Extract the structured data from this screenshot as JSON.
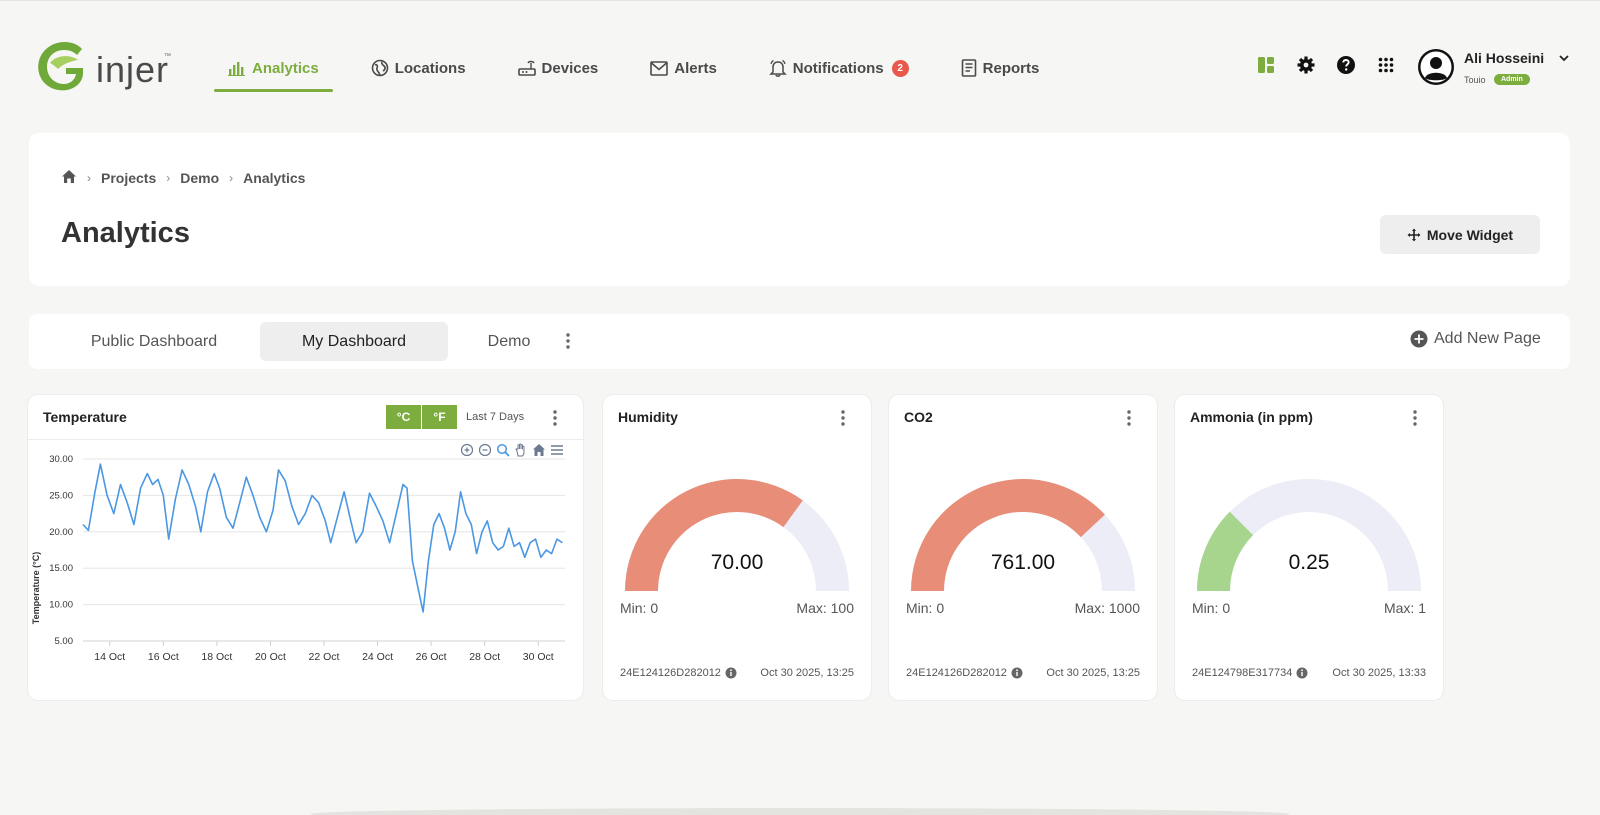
{
  "app": {
    "logo_text": "injer",
    "logo_tm": "™"
  },
  "nav": {
    "items": [
      {
        "label": "Analytics",
        "icon": "bar-chart-icon",
        "active": true
      },
      {
        "label": "Locations",
        "icon": "globe-icon"
      },
      {
        "label": "Devices",
        "icon": "router-icon"
      },
      {
        "label": "Alerts",
        "icon": "mail-icon"
      },
      {
        "label": "Notifications",
        "icon": "bell-icon",
        "badge": "2"
      },
      {
        "label": "Reports",
        "icon": "report-icon"
      }
    ]
  },
  "user": {
    "name": "Ali Hosseini",
    "org": "Touio",
    "role": "Admin"
  },
  "breadcrumb": [
    "Projects",
    "Demo",
    "Analytics"
  ],
  "page": {
    "title": "Analytics",
    "move_widget_label": "Move Widget"
  },
  "tabs": {
    "items": [
      "Public Dashboard",
      "My Dashboard",
      "Demo"
    ],
    "active": "My Dashboard",
    "add_label": "Add New Page"
  },
  "colors": {
    "brand": "#7cad3e",
    "gauge_high": "#e88d77",
    "gauge_low": "#a7d58e",
    "gauge_track": "#ededf7",
    "line": "#4a97e3",
    "badge": "#e9594b"
  },
  "temperature": {
    "title": "Temperature",
    "unit_c": "°C",
    "unit_f": "°F",
    "range": "Last 7 Days"
  },
  "chart_data": {
    "type": "line",
    "title": "Temperature",
    "ylabel": "Temperature (°C)",
    "xlabel": "",
    "ylim": [
      5,
      30
    ],
    "yticks": [
      "30.00",
      "25.00",
      "20.00",
      "15.00",
      "10.00",
      "5.00"
    ],
    "xticks": [
      "14 Oct",
      "16 Oct",
      "18 Oct",
      "20 Oct",
      "22 Oct",
      "24 Oct",
      "26 Oct",
      "28 Oct",
      "30 Oct"
    ],
    "xlim_days": [
      13,
      31
    ],
    "grid": true,
    "series": [
      {
        "values": [
          [
            13.0,
            21.0
          ],
          [
            13.2,
            20.2
          ],
          [
            13.45,
            25.5
          ],
          [
            13.65,
            29.3
          ],
          [
            13.9,
            25.0
          ],
          [
            14.15,
            22.5
          ],
          [
            14.4,
            26.5
          ],
          [
            14.65,
            24.0
          ],
          [
            14.9,
            21.0
          ],
          [
            15.15,
            26.0
          ],
          [
            15.4,
            28.0
          ],
          [
            15.6,
            26.5
          ],
          [
            15.8,
            27.2
          ],
          [
            16.0,
            25.0
          ],
          [
            16.2,
            19.0
          ],
          [
            16.45,
            24.5
          ],
          [
            16.7,
            28.5
          ],
          [
            16.95,
            26.5
          ],
          [
            17.2,
            23.5
          ],
          [
            17.4,
            20.0
          ],
          [
            17.65,
            25.5
          ],
          [
            17.9,
            28.0
          ],
          [
            18.1,
            26.0
          ],
          [
            18.35,
            22.0
          ],
          [
            18.6,
            20.5
          ],
          [
            18.85,
            24.0
          ],
          [
            19.1,
            27.5
          ],
          [
            19.35,
            25.0
          ],
          [
            19.6,
            22.0
          ],
          [
            19.85,
            20.0
          ],
          [
            20.1,
            23.0
          ],
          [
            20.3,
            28.5
          ],
          [
            20.55,
            27.0
          ],
          [
            20.8,
            23.5
          ],
          [
            21.05,
            21.0
          ],
          [
            21.3,
            22.5
          ],
          [
            21.55,
            25.0
          ],
          [
            21.8,
            24.0
          ],
          [
            22.05,
            21.5
          ],
          [
            22.25,
            18.5
          ],
          [
            22.5,
            22.0
          ],
          [
            22.75,
            25.5
          ],
          [
            23.0,
            21.5
          ],
          [
            23.2,
            18.5
          ],
          [
            23.45,
            20.0
          ],
          [
            23.7,
            25.3
          ],
          [
            23.95,
            23.5
          ],
          [
            24.2,
            21.5
          ],
          [
            24.45,
            18.5
          ],
          [
            24.7,
            22.5
          ],
          [
            24.95,
            26.5
          ],
          [
            25.1,
            26.0
          ],
          [
            25.3,
            16.0
          ],
          [
            25.5,
            12.5
          ],
          [
            25.7,
            9.0
          ],
          [
            25.9,
            16.0
          ],
          [
            26.1,
            21.0
          ],
          [
            26.3,
            22.5
          ],
          [
            26.5,
            20.5
          ],
          [
            26.7,
            17.5
          ],
          [
            26.9,
            20.0
          ],
          [
            27.1,
            25.5
          ],
          [
            27.3,
            22.5
          ],
          [
            27.5,
            21.0
          ],
          [
            27.7,
            17.0
          ],
          [
            27.9,
            20.0
          ],
          [
            28.1,
            21.5
          ],
          [
            28.3,
            18.5
          ],
          [
            28.5,
            17.5
          ],
          [
            28.7,
            18.0
          ],
          [
            28.9,
            20.5
          ],
          [
            29.1,
            18.0
          ],
          [
            29.3,
            18.5
          ],
          [
            29.5,
            16.5
          ],
          [
            29.7,
            18.5
          ],
          [
            29.9,
            19.0
          ],
          [
            30.1,
            16.5
          ],
          [
            30.3,
            17.5
          ],
          [
            30.5,
            17.0
          ],
          [
            30.7,
            19.0
          ],
          [
            30.9,
            18.5
          ]
        ]
      }
    ]
  },
  "gauges": [
    {
      "title": "Humidity",
      "value": 70.0,
      "value_label": "70.00",
      "min": 0,
      "max": 100,
      "min_label": "Min: 0",
      "max_label": "Max: 100",
      "device": "24E124126D282012",
      "time": "Oct 30 2025, 13:25",
      "color": "#e88d77"
    },
    {
      "title": "CO2",
      "value": 761.0,
      "value_label": "761.00",
      "min": 0,
      "max": 1000,
      "min_label": "Min: 0",
      "max_label": "Max: 1000",
      "device": "24E124126D282012",
      "time": "Oct 30 2025, 13:25",
      "color": "#e88d77"
    },
    {
      "title": "Ammonia (in ppm)",
      "value": 0.25,
      "value_label": "0.25",
      "min": 0,
      "max": 1,
      "min_label": "Min: 0",
      "max_label": "Max: 1",
      "device": "24E124798E317734",
      "time": "Oct 30 2025, 13:33",
      "color": "#a7d58e"
    }
  ]
}
